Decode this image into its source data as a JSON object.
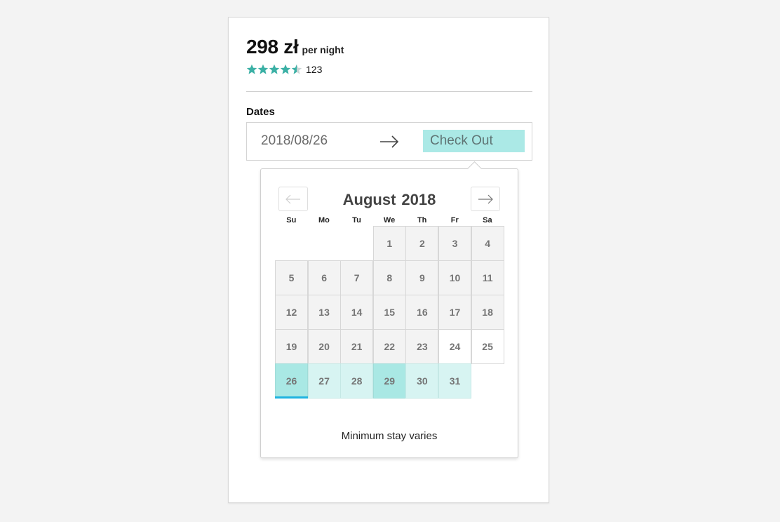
{
  "listing": {
    "price": "298 zł",
    "per_night": "per night",
    "rating_stars": 4.5,
    "review_count": "123"
  },
  "dates": {
    "label": "Dates",
    "check_in": "2018/08/26",
    "check_out_placeholder": "Check Out"
  },
  "calendar": {
    "month": "August",
    "year": "2018",
    "weekdays": [
      "Su",
      "Mo",
      "Tu",
      "We",
      "Th",
      "Fr",
      "Sa"
    ],
    "first_weekday_index": 3,
    "days_in_month": 31,
    "selected_start": 26,
    "highlighted_day": 29,
    "range_days": [
      27,
      28,
      30,
      31
    ],
    "available_white_days": [
      24,
      25
    ],
    "footer_note": "Minimum stay varies"
  },
  "colors": {
    "star": "#3bb0a5",
    "star_empty": "#c9d4d4",
    "checkout_bg": "#abe9e6",
    "selected_bg": "#a9e8e4",
    "range_bg": "#d7f4f2",
    "today_underline": "#1fb3e0"
  },
  "icons": {
    "arrow_separator": "arrow-right-icon",
    "prev_month": "arrow-left-icon",
    "next_month": "arrow-right-icon",
    "star": "star-icon"
  }
}
